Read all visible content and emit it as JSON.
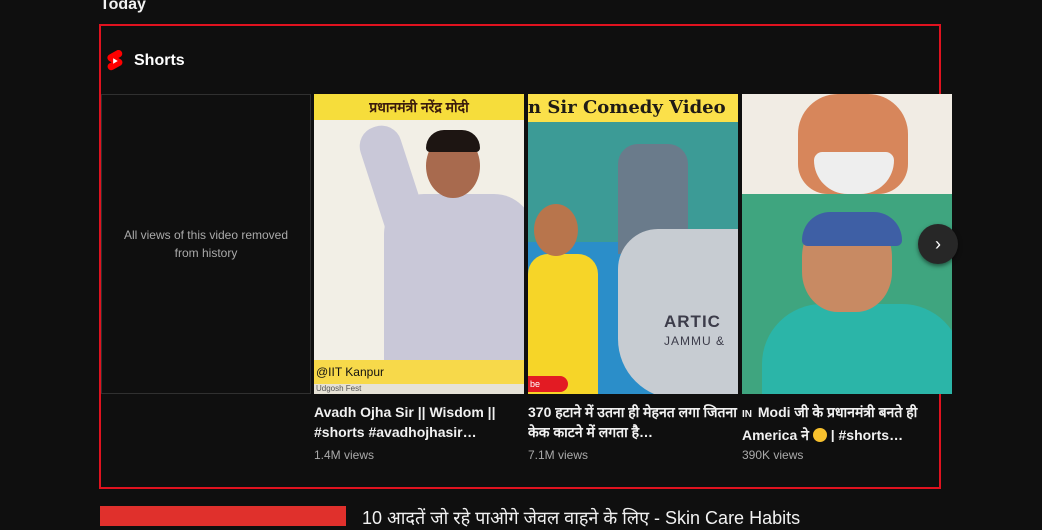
{
  "section": {
    "title": "Today"
  },
  "shorts": {
    "header": "Shorts",
    "icon": "shorts-logo-icon",
    "removed_item": {
      "message": "All views of this video removed from history"
    },
    "items": [
      {
        "title": "Avadh Ojha Sir || Wisdom || #shorts #avadhojhasir…",
        "views": "1.4M views",
        "thumb_banner": "प्रधानमंत्री नरेंद्र मोदी",
        "thumb_caption": "@IIT Kanpur",
        "thumb_caption2": "Udgosh Fest"
      },
      {
        "title": "370 हटाने में उतना ही मेहनत लगा जितना केक काटने में लगता है…",
        "views": "7.1M views",
        "thumb_banner": "n Sir Comedy Video",
        "thumb_map_text": "ARTIC",
        "thumb_map_text2": "JAMMU &",
        "thumb_badge": "be"
      },
      {
        "title_prefix": "IN",
        "title": "Modi जी के प्रधानमंत्री बनते ही America ने",
        "title_suffix": "| #shorts…",
        "views": "390K views"
      }
    ]
  },
  "next_video": {
    "title": "10 आदतें जो रहे पाओगे जेवल वाहने के लिए - Skin Care Habits"
  },
  "colors": {
    "background": "#0f0f0f",
    "highlight_border": "#e0121f",
    "secondary_text": "#aaaaaa"
  }
}
